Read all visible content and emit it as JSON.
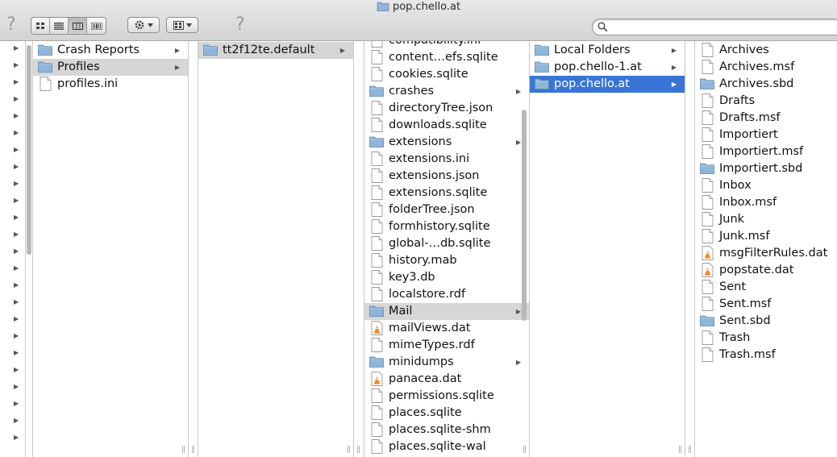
{
  "window": {
    "title": "pop.chello.at"
  },
  "toolbar": {
    "help_left": "?",
    "help_mid": "?",
    "view_buttons": [
      "icon-view",
      "list-view",
      "column-view",
      "coverflow-view"
    ],
    "active_view": "column-view",
    "action_icon": "gear-icon",
    "arrange_icon": "grid-icon",
    "search_placeholder": ""
  },
  "columns": [
    {
      "items": [
        {
          "label": "Crash Reports",
          "type": "folder",
          "arrow": true
        },
        {
          "label": "Profiles",
          "type": "folder",
          "arrow": true,
          "selected": "gray"
        },
        {
          "label": "profiles.ini",
          "type": "file"
        }
      ]
    },
    {
      "items": [
        {
          "label": "tt2f12te.default",
          "type": "folder",
          "arrow": true,
          "selected": "gray"
        }
      ]
    },
    {
      "items": [
        {
          "label": "compatibility.ini",
          "type": "file"
        },
        {
          "label": "content…efs.sqlite",
          "type": "file"
        },
        {
          "label": "cookies.sqlite",
          "type": "file"
        },
        {
          "label": "crashes",
          "type": "folder",
          "arrow": true
        },
        {
          "label": "directoryTree.json",
          "type": "file"
        },
        {
          "label": "downloads.sqlite",
          "type": "file"
        },
        {
          "label": "extensions",
          "type": "folder",
          "arrow": true
        },
        {
          "label": "extensions.ini",
          "type": "file"
        },
        {
          "label": "extensions.json",
          "type": "file"
        },
        {
          "label": "extensions.sqlite",
          "type": "file"
        },
        {
          "label": "folderTree.json",
          "type": "file"
        },
        {
          "label": "formhistory.sqlite",
          "type": "file"
        },
        {
          "label": "global-…db.sqlite",
          "type": "file"
        },
        {
          "label": "history.mab",
          "type": "file"
        },
        {
          "label": "key3.db",
          "type": "file"
        },
        {
          "label": "localstore.rdf",
          "type": "file"
        },
        {
          "label": "Mail",
          "type": "folder",
          "arrow": true,
          "selected": "gray"
        },
        {
          "label": "mailViews.dat",
          "type": "vlc"
        },
        {
          "label": "mimeTypes.rdf",
          "type": "file"
        },
        {
          "label": "minidumps",
          "type": "folder",
          "arrow": true
        },
        {
          "label": "panacea.dat",
          "type": "vlc"
        },
        {
          "label": "permissions.sqlite",
          "type": "file"
        },
        {
          "label": "places.sqlite",
          "type": "file"
        },
        {
          "label": "places.sqlite-shm",
          "type": "file"
        },
        {
          "label": "places.sqlite-wal",
          "type": "file"
        }
      ]
    },
    {
      "items": [
        {
          "label": "Local Folders",
          "type": "folder",
          "arrow": true
        },
        {
          "label": "pop.chello-1.at",
          "type": "folder",
          "arrow": true
        },
        {
          "label": "pop.chello.at",
          "type": "folder",
          "arrow": true,
          "selected": "blue"
        }
      ]
    },
    {
      "items": [
        {
          "label": "Archives",
          "type": "file"
        },
        {
          "label": "Archives.msf",
          "type": "file"
        },
        {
          "label": "Archives.sbd",
          "type": "folder"
        },
        {
          "label": "Drafts",
          "type": "file"
        },
        {
          "label": "Drafts.msf",
          "type": "file"
        },
        {
          "label": "Importiert",
          "type": "file"
        },
        {
          "label": "Importiert.msf",
          "type": "file"
        },
        {
          "label": "Importiert.sbd",
          "type": "folder"
        },
        {
          "label": "Inbox",
          "type": "file"
        },
        {
          "label": "Inbox.msf",
          "type": "file"
        },
        {
          "label": "Junk",
          "type": "file"
        },
        {
          "label": "Junk.msf",
          "type": "file"
        },
        {
          "label": "msgFilterRules.dat",
          "type": "vlc"
        },
        {
          "label": "popstate.dat",
          "type": "vlc"
        },
        {
          "label": "Sent",
          "type": "file"
        },
        {
          "label": "Sent.msf",
          "type": "file"
        },
        {
          "label": "Sent.sbd",
          "type": "folder"
        },
        {
          "label": "Trash",
          "type": "file"
        },
        {
          "label": "Trash.msf",
          "type": "file"
        }
      ]
    }
  ],
  "colors": {
    "selection_blue": "#3875d7",
    "selection_gray": "#d6d6d6",
    "folder_blue": "#8fb6d9"
  }
}
